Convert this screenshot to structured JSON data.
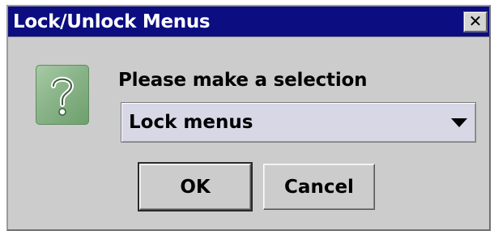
{
  "window": {
    "title": "Lock/Unlock Menus",
    "close_glyph": "✕"
  },
  "icon": {
    "name": "question-mark-icon",
    "color": "#8ab489"
  },
  "prompt": {
    "label": "Please make a selection"
  },
  "selection": {
    "value": "Lock menus"
  },
  "buttons": {
    "ok_label": "OK",
    "cancel_label": "Cancel"
  },
  "colors": {
    "titlebar": "#0b0d80",
    "dialog_bg": "#cccccc",
    "combo_bg": "#d7d7e6"
  }
}
